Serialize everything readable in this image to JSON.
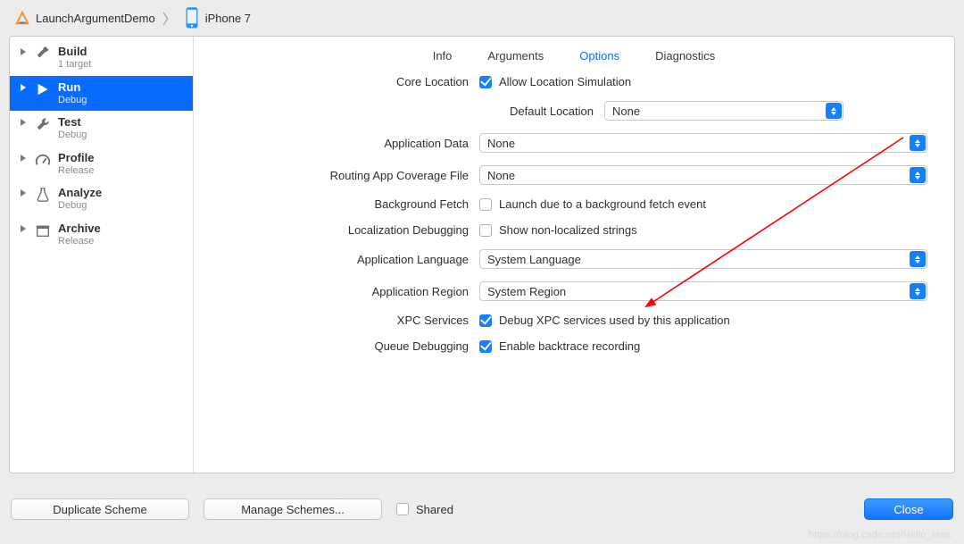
{
  "breadcrumb": {
    "project": "LaunchArgumentDemo",
    "device": "iPhone 7"
  },
  "sidebar": {
    "items": [
      {
        "title": "Build",
        "sub": "1 target"
      },
      {
        "title": "Run",
        "sub": "Debug"
      },
      {
        "title": "Test",
        "sub": "Debug"
      },
      {
        "title": "Profile",
        "sub": "Release"
      },
      {
        "title": "Analyze",
        "sub": "Debug"
      },
      {
        "title": "Archive",
        "sub": "Release"
      }
    ]
  },
  "tabs": {
    "info": "Info",
    "arguments": "Arguments",
    "options": "Options",
    "diagnostics": "Diagnostics"
  },
  "form": {
    "core_location_label": "Core Location",
    "core_location_check": "Allow Location Simulation",
    "default_location_label": "Default Location",
    "default_location_value": "None",
    "app_data_label": "Application Data",
    "app_data_value": "None",
    "routing_label": "Routing App Coverage File",
    "routing_value": "None",
    "background_fetch_label": "Background Fetch",
    "background_fetch_check": "Launch due to a background fetch event",
    "loc_debug_label": "Localization Debugging",
    "loc_debug_check": "Show non-localized strings",
    "app_lang_label": "Application Language",
    "app_lang_value": "System Language",
    "app_region_label": "Application Region",
    "app_region_value": "System Region",
    "xpc_label": "XPC Services",
    "xpc_check": "Debug XPC services used by this application",
    "queue_label": "Queue Debugging",
    "queue_check": "Enable backtrace recording"
  },
  "footer": {
    "duplicate": "Duplicate Scheme",
    "manage": "Manage Schemes...",
    "shared": "Shared",
    "close": "Close"
  },
  "watermark": "https://blog.csdn.net/Hello_Hwc"
}
